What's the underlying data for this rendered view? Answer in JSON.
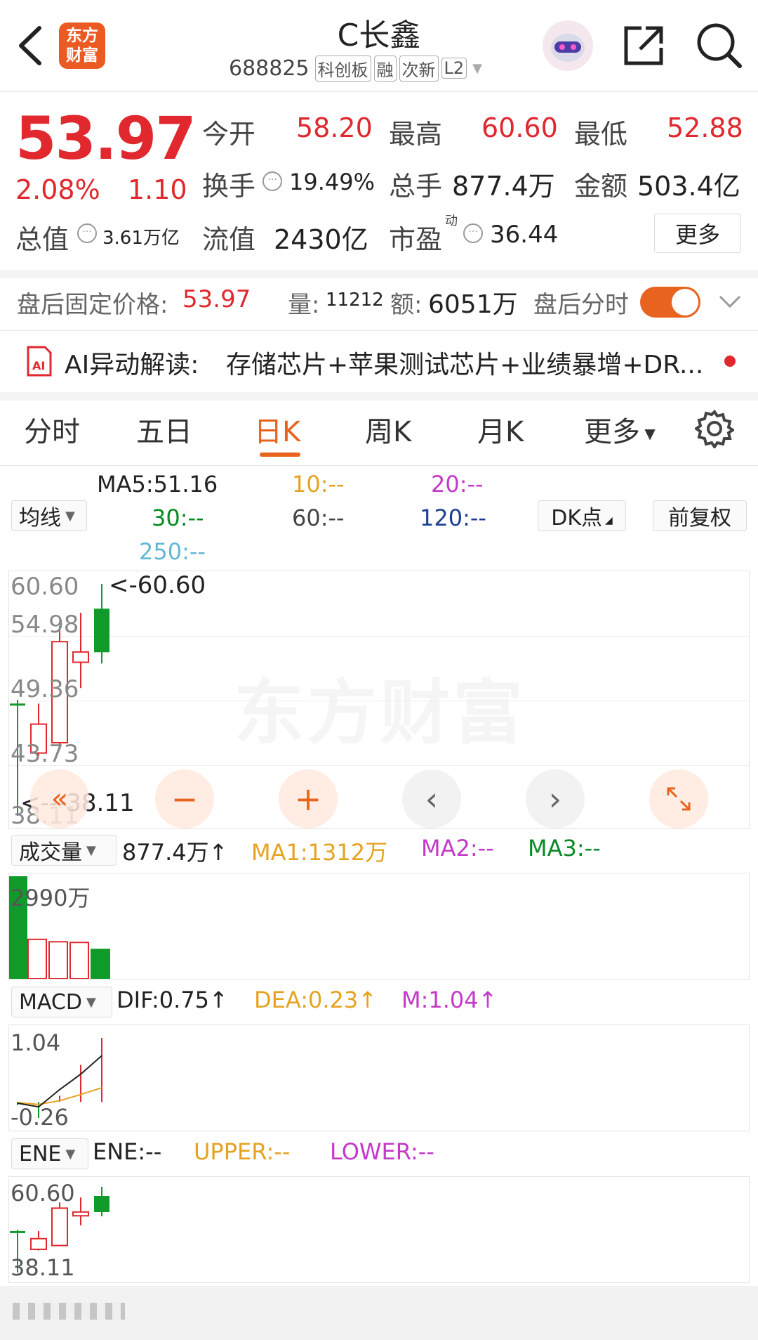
{
  "header": {
    "logo_line1": "东方",
    "logo_line2": "财富",
    "title": "C长鑫",
    "code": "688825",
    "tags": [
      "科创板",
      "融",
      "次新",
      "L2"
    ]
  },
  "quote": {
    "price": "53.97",
    "change_pct": "2.08%",
    "change": "1.10",
    "open_label": "今开",
    "open": "58.20",
    "high_label": "最高",
    "high": "60.60",
    "low_label": "最低",
    "low": "52.88",
    "turnover_label": "换手",
    "turnover": "19.49%",
    "volume_label": "总手",
    "volume": "877.4万",
    "amount_label": "金额",
    "amount": "503.4亿",
    "mktcap_label": "总值",
    "mktcap": "3.61万亿",
    "float_label": "流值",
    "float": "2430亿",
    "pe_label": "市盈",
    "pe_sup": "动",
    "pe": "36.44",
    "more_button": "更多"
  },
  "after_hours": {
    "price_label": "盘后固定价格:",
    "price": "53.97",
    "vol_label": "量:",
    "vol": "11212",
    "amt_label": "额:",
    "amt": "6051万",
    "toggle_label": "盘后分时",
    "toggle_on": true
  },
  "ai": {
    "label": "AI异动解读:",
    "text": "存储芯片+苹果测试芯片+业绩暴增+DR..."
  },
  "tabs": [
    "分时",
    "五日",
    "日K",
    "周K",
    "月K",
    "更多"
  ],
  "active_tab": "日K",
  "ma": {
    "selector": "均线",
    "ma5": "MA5:51.16",
    "ma10": "10:--",
    "ma20": "20:--",
    "ma30": "30:--",
    "ma60": "60:--",
    "ma120": "120:--",
    "ma250": "250:--",
    "dk_button": "DK点",
    "adjust_button": "前复权"
  },
  "kline": {
    "watermark": "东方财富",
    "y_labels": [
      "60.60",
      "54.98",
      "49.36",
      "43.73",
      "38.11"
    ],
    "high_marker": "<-60.60",
    "low_marker": "<---38.11"
  },
  "volume": {
    "selector": "成交量",
    "value": "877.4万",
    "ma1": "MA1:1312万",
    "ma2": "MA2:--",
    "ma3": "MA3:--",
    "max_label": "2990万"
  },
  "macd": {
    "selector": "MACD",
    "dif": "DIF:0.75",
    "dea": "DEA:0.23",
    "m": "M:1.04",
    "top_label": "1.04",
    "bottom_label": "-0.26"
  },
  "ene": {
    "selector": "ENE",
    "ene": "ENE:--",
    "upper": "UPPER:--",
    "lower": "LOWER:--",
    "top_label": "60.60",
    "bottom_label": "38.11"
  },
  "chart_data": {
    "type": "candlestick",
    "y_range": [
      38.11,
      60.6
    ],
    "candles": [
      {
        "open": 49.0,
        "close": 49.0,
        "high": 49.36,
        "low": 38.11,
        "dir": "down"
      },
      {
        "open": 44.2,
        "close": 47.0,
        "high": 49.0,
        "low": 43.9,
        "dir": "up"
      },
      {
        "open": 45.2,
        "close": 55.0,
        "high": 56.5,
        "low": 45.0,
        "dir": "up"
      },
      {
        "open": 53.0,
        "close": 54.0,
        "high": 57.8,
        "low": 50.5,
        "dir": "up"
      },
      {
        "open": 58.2,
        "close": 53.97,
        "high": 60.6,
        "low": 52.88,
        "dir": "down"
      }
    ],
    "volume_range": [
      0,
      2990
    ],
    "volumes": [
      2990,
      1150,
      1080,
      1060,
      877.4
    ],
    "macd_range": [
      -0.26,
      1.04
    ],
    "macd_bars": [
      -0.05,
      -0.26,
      0.1,
      0.6,
      1.04
    ],
    "dif": [
      -0.02,
      -0.08,
      0.2,
      0.45,
      0.75
    ],
    "dea": [
      -0.01,
      -0.04,
      0.02,
      0.12,
      0.23
    ]
  },
  "colors": {
    "up": "#e0282e",
    "down": "#0f9a2a",
    "accent": "#e8631e"
  },
  "icons": {
    "back": "back-arrow-icon",
    "share": "share-icon",
    "search": "search-icon",
    "settings": "gear-icon",
    "avatar": "robot-avatar-icon"
  }
}
